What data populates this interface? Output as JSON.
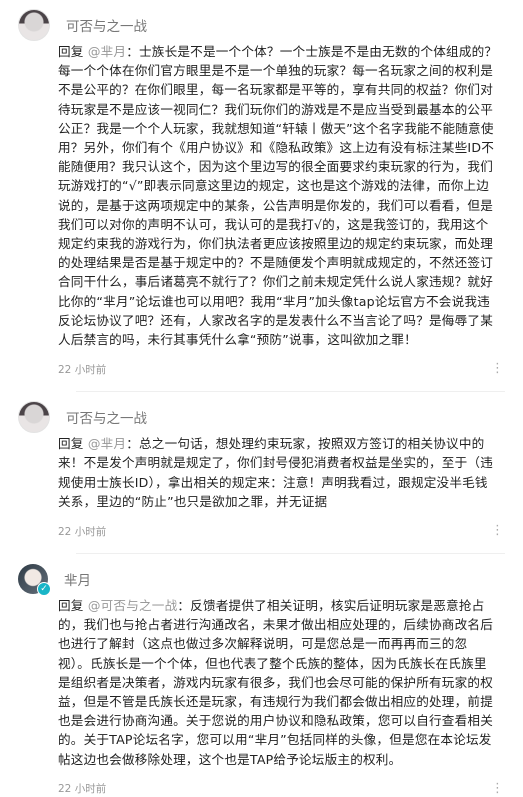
{
  "comments": [
    {
      "username": "可否与之一战",
      "reply_word": "回复",
      "mention": "@芈月",
      "text": "：士族长是不是一个个体？一个士族是不是由无数的个体组成的？每一个个体在你们官方眼里是不是一个单独的玩家？每一名玩家之间的权利是不是公平的？在你们眼里，每一名玩家都是平等的，享有共同的权益？你们对待玩家是不是应该一视同仁？我们玩你们的游戏是不是应当受到最基本的公平公正？我是一个个人玩家，我就想知道“轩辕丨傲天”这个名字我能不能随意使用？另外，你们有个《用户协议》和《隐私政策》这上边有没有标注某些ID不能随便用？我只认这个，因为这个里边写的很全面要求约束玩家的行为，我们玩游戏打的“√”即表示同意这里边的规定，这也是这个游戏的法律，而你上边说的，是基于这两项规定中的某条，公告声明是你发的，我们可以看看，但是我们可以对你的声明不认可，我认可的是我打√的，这是我签订的，我用这个规定约束我的游戏行为，你们执法者更应该按照里边的规定约束玩家，而处理的处理结果是否是基于规定中的？不是随便发个声明就成规定的，不然还签订合同干什么，事后诸葛亮不就行了？你们之前未规定凭什么说人家违规？就好比你的“芈月”论坛谁也可以用吧？我用“芈月”加头像tap论坛官方不会说我违反论坛协议了吧？还有，人家改名字的是发表什么不当言论了吗？是侮辱了某人后禁言的吗，未行其事凭什么拿“预防”说事，这叫欲加之罪！",
      "time": "22 小时前",
      "more": "⋮"
    },
    {
      "username": "可否与之一战",
      "reply_word": "回复",
      "mention": "@芈月",
      "text": "：总之一句话，想处理约束玩家，按照双方签订的相关协议中的来！不是发个声明就是规定了，你们封号侵犯消费者权益是坐实的，至于（违规使用士族长ID），拿出相关的规定来：注意！声明我看过，跟规定没半毛钱关系，里边的“防止”也只是欲加之罪，并无证据",
      "time": "22 小时前",
      "more": "⋮"
    },
    {
      "username": "芈月",
      "verified_icon": "✓",
      "reply_word": "回复",
      "mention": "@可否与之一战",
      "text": "：反馈者提供了相关证明，核实后证明玩家是恶意抢占的，我们也与抢占者进行沟通改名，未果才做出相应处理的，后续协商改名后也进行了解封（这点也做过多次解释说明，可是您总是一而再再而三的忽视）。氏族长是一个个体，但也代表了整个氏族的整体，因为氏族长在氏族里是组织者是决策者，游戏内玩家有很多，我们也会尽可能的保护所有玩家的权益，但是不管是氏族长还是玩家，有违规行为我们都会做出相应的处理，前提也是会进行协商沟通。关于您说的用户协议和隐私政策，您可以自行查看相关的。关于TAP论坛名字，您可以用“芈月”包括同样的头像，但是您在本论坛发帖这边也会做移除处理，这个也是TAP给予论坛版主的权利。",
      "time": "22 小时前",
      "more": "⋮"
    }
  ]
}
